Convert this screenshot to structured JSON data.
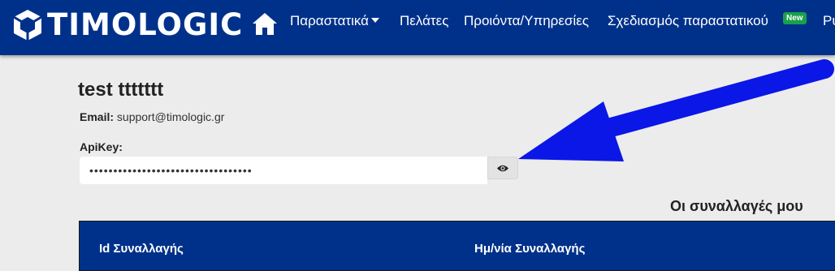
{
  "brand": {
    "name": "TIMOLOGIC"
  },
  "nav": {
    "items": [
      {
        "label": "Παραστατικά"
      },
      {
        "label": "Πελάτες"
      },
      {
        "label": "Προιόντα/Υπηρεσίες"
      },
      {
        "label": "Σχεδιασμός παραστατικού"
      },
      {
        "label": "Ρυ"
      }
    ],
    "new_badge": "New"
  },
  "profile": {
    "name": "test ttttttt",
    "email_label": "Email:",
    "email_value": "support@timologic.gr",
    "apikey_label": "ApiKey:",
    "apikey_value": "••••••••••••••••••••••••••••••••••"
  },
  "transactions": {
    "title": "Οι συναλλαγές μου",
    "columns": [
      "Id Συναλλαγής",
      "Ημ/νία Συναλλαγής"
    ]
  },
  "colors": {
    "navbar": "#00318a",
    "badge": "#18a04a",
    "annotation_arrow": "#0a17e6",
    "background": "#ececec"
  },
  "icons": {
    "home": "home-icon",
    "eye": "eye-icon",
    "dropdown": "caret-down-icon"
  }
}
